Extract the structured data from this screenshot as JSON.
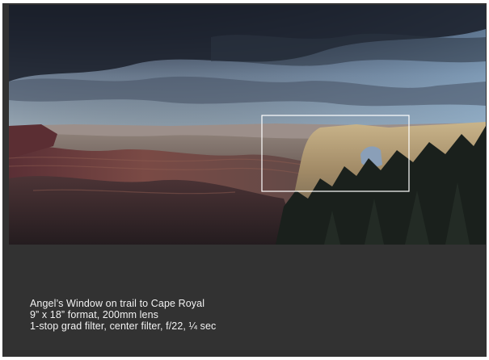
{
  "slide": {
    "background": "#323232",
    "photo": {
      "subject": "canyon-landscape-photo",
      "highlight_box_color": "#ffffff"
    },
    "caption": {
      "line1": "Angel’s Window on trail to Cape Royal",
      "line2": "9” x 18” format, 200mm lens",
      "line3": "1-stop grad filter, center filter, f/22, ¼ sec"
    }
  }
}
